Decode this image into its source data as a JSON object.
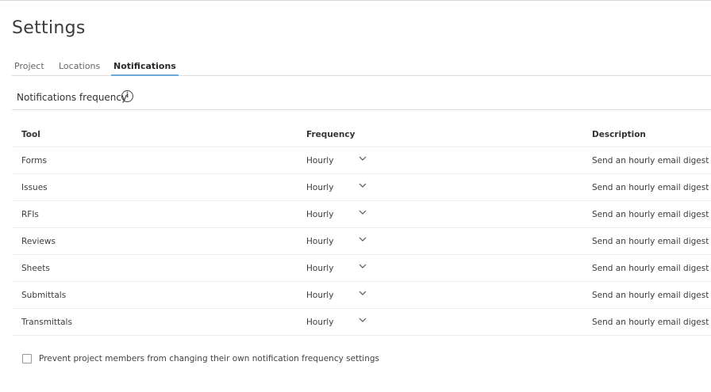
{
  "title": "Settings",
  "tabs": [
    {
      "label": "Project"
    },
    {
      "label": "Locations"
    },
    {
      "label": "Notifications",
      "active": true
    }
  ],
  "section": {
    "title": "Notifications frequency",
    "info_icon": "info-icon"
  },
  "table": {
    "headers": {
      "tool": "Tool",
      "frequency": "Frequency",
      "description": "Description"
    },
    "rows": [
      {
        "tool": "Forms",
        "frequency": "Hourly",
        "description": "Send an hourly email digest"
      },
      {
        "tool": "Issues",
        "frequency": "Hourly",
        "description": "Send an hourly email digest"
      },
      {
        "tool": "RFIs",
        "frequency": "Hourly",
        "description": "Send an hourly email digest"
      },
      {
        "tool": "Reviews",
        "frequency": "Hourly",
        "description": "Send an hourly email digest"
      },
      {
        "tool": "Sheets",
        "frequency": "Hourly",
        "description": "Send an hourly email digest"
      },
      {
        "tool": "Submittals",
        "frequency": "Hourly",
        "description": "Send an hourly email digest"
      },
      {
        "tool": "Transmittals",
        "frequency": "Hourly",
        "description": "Send an hourly email digest"
      }
    ]
  },
  "prevent_checkbox": {
    "label": "Prevent project members from changing their own notification frequency settings",
    "checked": false
  },
  "colors": {
    "accent": "#6aa9d9"
  }
}
